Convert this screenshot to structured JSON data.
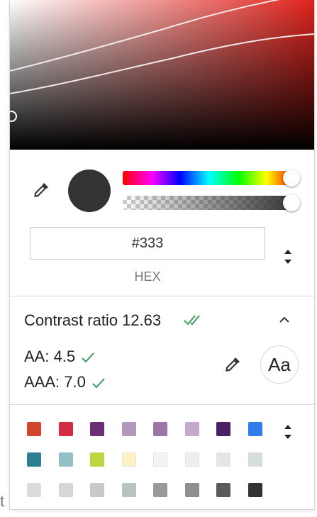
{
  "background_page": {
    "edge_text": "t"
  },
  "color": {
    "hex_value": "#333",
    "format_label": "HEX",
    "preview_color": "#333333"
  },
  "contrast": {
    "title": "Contrast ratio",
    "ratio": "12.63",
    "aa_label": "AA: 4.5",
    "aaa_label": "AAA: 7.0",
    "preview_button_label": "Aa",
    "pass_color": "#3c9a5f"
  },
  "icons": {
    "eyedropper": "eyedropper-icon",
    "format_toggle": "up-down-arrows-icon",
    "double_check": "double-check-icon",
    "check": "check-icon",
    "chevron": "chevron-up-icon"
  },
  "palette": {
    "swatches": [
      "#d0472e",
      "#d42a44",
      "#6b2f78",
      "#b398bd",
      "#9d76a8",
      "#c3a9cc",
      "#4a2066",
      "#2e7dea",
      "#2e7f93",
      "#93c1c3",
      "#bfd441",
      "#fdf1c3",
      "#f4f4f4",
      "#eeeeee",
      "#e4e6e6",
      "#d7dcdc",
      "#dcdcdc",
      "#d6d6d6",
      "#c9c9c9",
      "#b8c3c0",
      "#999999",
      "#8f8f8f",
      "#5a5a5a",
      "#333333"
    ]
  }
}
